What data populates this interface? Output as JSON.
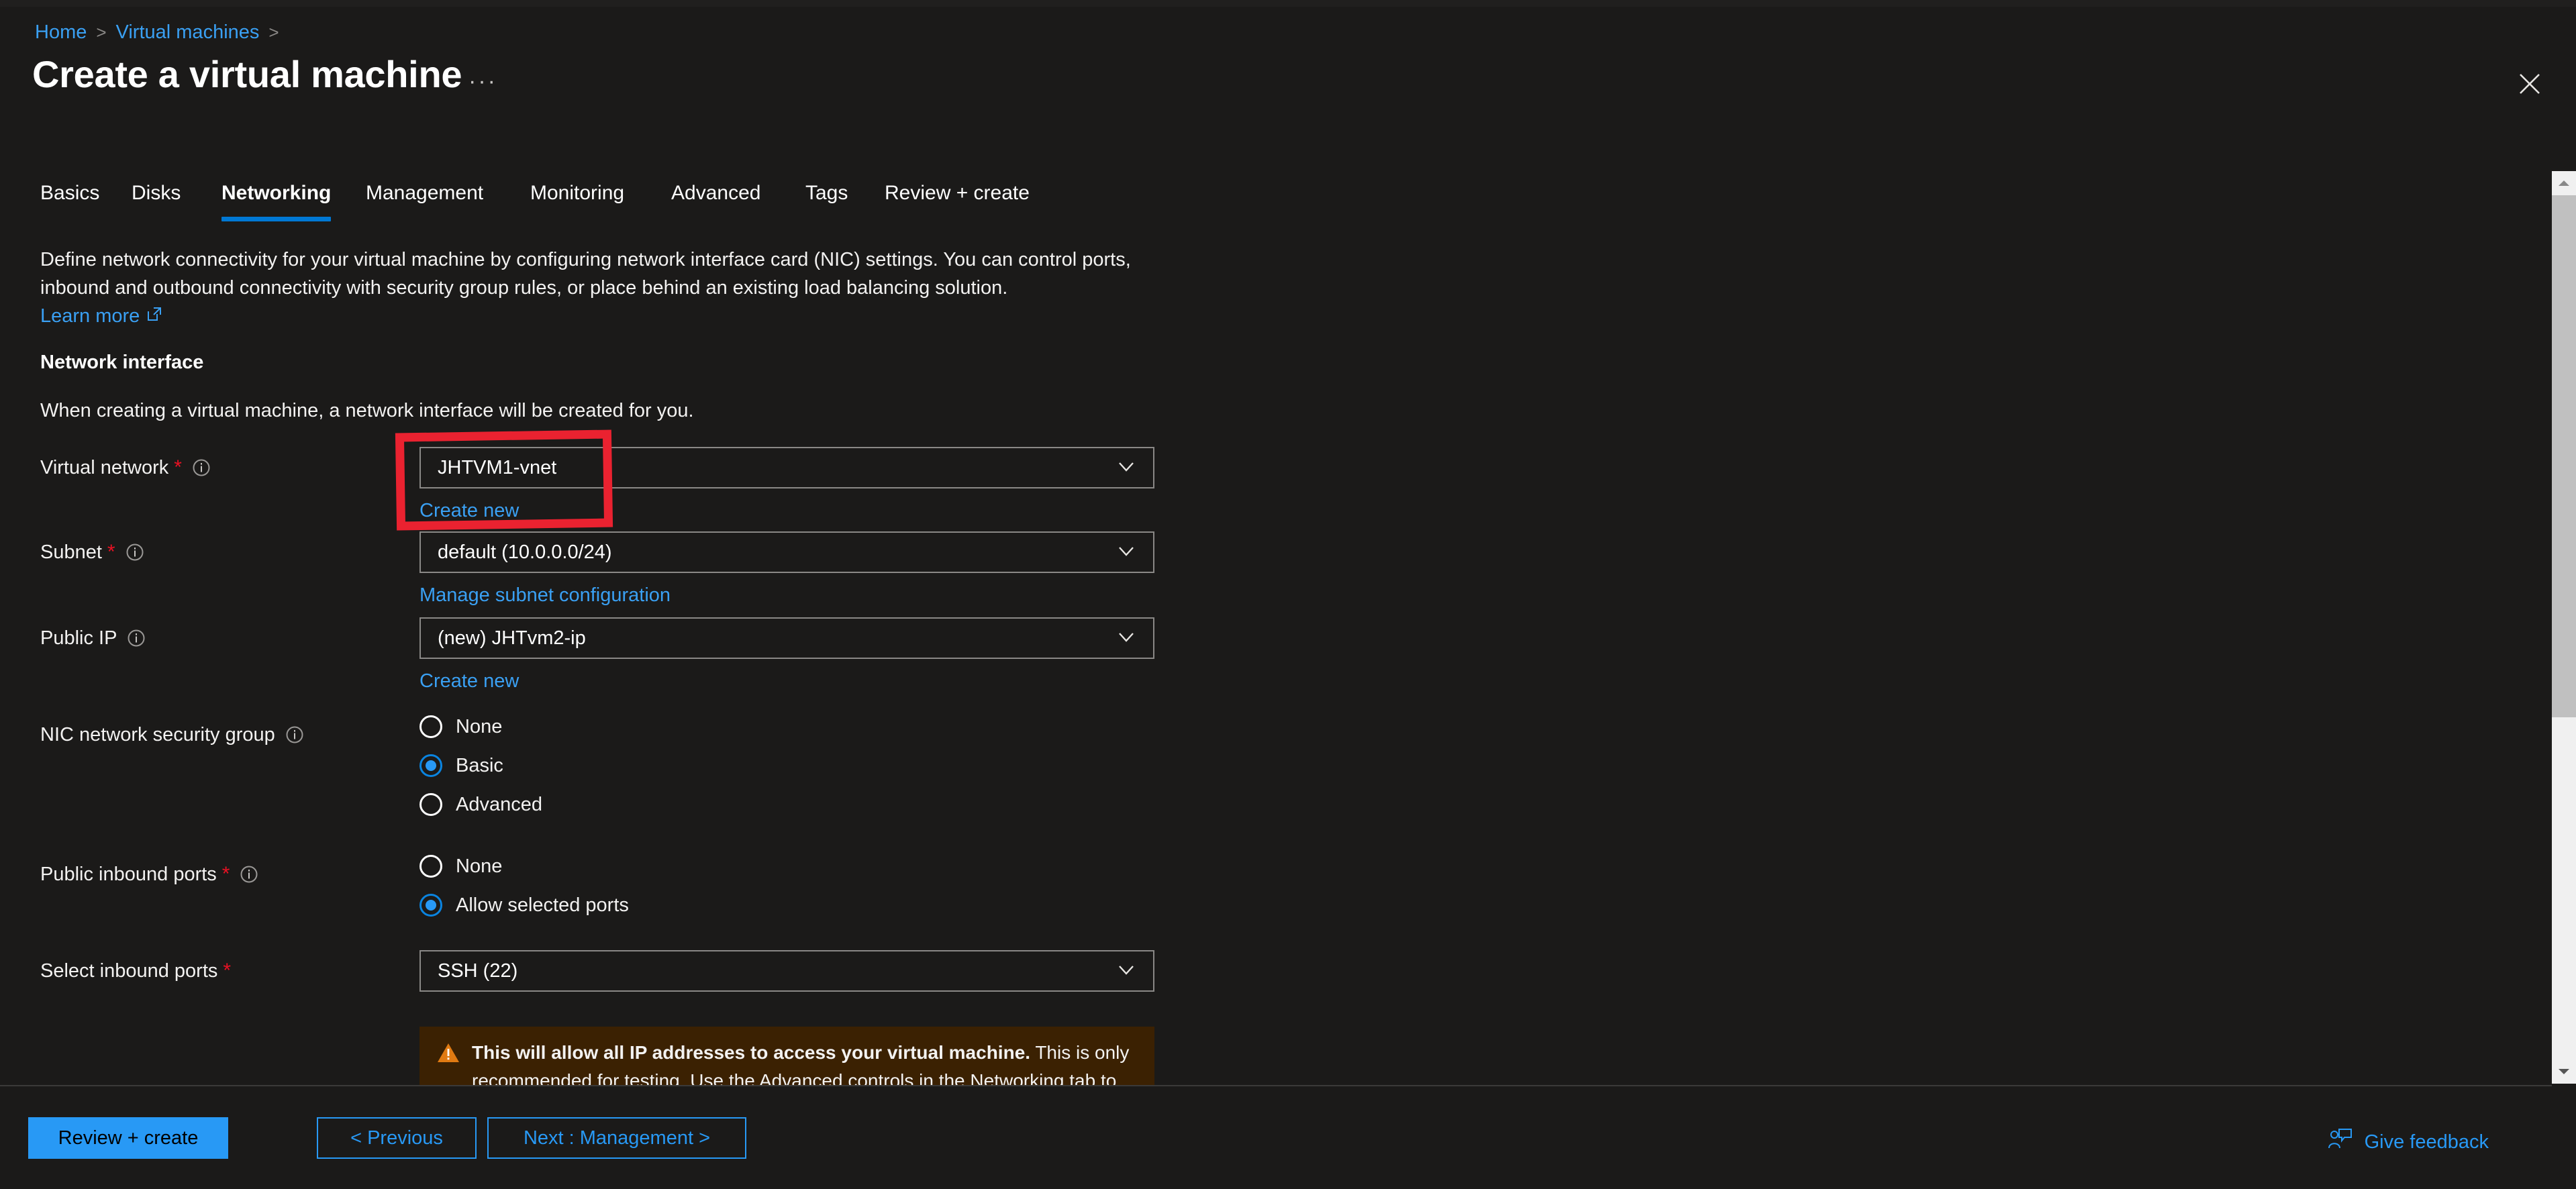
{
  "breadcrumb": {
    "items": [
      "Home",
      "Virtual machines"
    ],
    "separator": ">"
  },
  "header": {
    "title": "Create a virtual machine",
    "ellipsis": "···",
    "close_icon": "close-icon"
  },
  "tabs": [
    {
      "label": "Basics",
      "active": false
    },
    {
      "label": "Disks",
      "active": false
    },
    {
      "label": "Networking",
      "active": true
    },
    {
      "label": "Management",
      "active": false
    },
    {
      "label": "Monitoring",
      "active": false
    },
    {
      "label": "Advanced",
      "active": false
    },
    {
      "label": "Tags",
      "active": false
    },
    {
      "label": "Review + create",
      "active": false
    }
  ],
  "intro": {
    "paragraph": "Define network connectivity for your virtual machine by configuring network interface card (NIC) settings. You can control ports, inbound and outbound connectivity with security group rules, or place behind an existing load balancing solution.",
    "learn_more": "Learn more",
    "learn_more_icon": "external-link-icon"
  },
  "network_interface": {
    "heading": "Network interface",
    "subtext": "When creating a virtual machine, a network interface will be created for you."
  },
  "fields": {
    "virtual_network": {
      "label": "Virtual network",
      "required": true,
      "info_icon": "info-icon",
      "value": "JHTVM1-vnet",
      "sublink": "Create new",
      "chevron_icon": "chevron-down-icon",
      "highlighted": true
    },
    "subnet": {
      "label": "Subnet",
      "required": true,
      "info_icon": "info-icon",
      "value": "default (10.0.0.0/24)",
      "sublink": "Manage subnet configuration",
      "chevron_icon": "chevron-down-icon"
    },
    "public_ip": {
      "label": "Public IP",
      "required": false,
      "info_icon": "info-icon",
      "value": "(new) JHTvm2-ip",
      "sublink": "Create new",
      "chevron_icon": "chevron-down-icon"
    },
    "nic_nsg": {
      "label": "NIC network security group",
      "required": false,
      "info_icon": "info-icon",
      "options": [
        {
          "label": "None",
          "selected": false
        },
        {
          "label": "Basic",
          "selected": true
        },
        {
          "label": "Advanced",
          "selected": false
        }
      ]
    },
    "public_inbound_ports": {
      "label": "Public inbound ports",
      "required": true,
      "info_icon": "info-icon",
      "options": [
        {
          "label": "None",
          "selected": false
        },
        {
          "label": "Allow selected ports",
          "selected": true
        }
      ]
    },
    "select_inbound_ports": {
      "label": "Select inbound ports",
      "required": true,
      "value": "SSH (22)",
      "chevron_icon": "chevron-down-icon"
    }
  },
  "warning": {
    "icon": "warning-triangle-icon",
    "bold": "This will allow all IP addresses to access your virtual machine.",
    "rest": " This is only recommended for testing.  Use the Advanced controls in the Networking tab to"
  },
  "footer": {
    "review_create": "Review + create",
    "previous": "< Previous",
    "next": "Next : Management >",
    "feedback": "Give feedback",
    "feedback_icon": "feedback-person-icon"
  },
  "scrollbar": {
    "up_icon": "caret-up-icon",
    "down_icon": "caret-down-icon",
    "thumb": "scroll-thumb"
  },
  "colors": {
    "background": "#1b1a19",
    "accent": "#2899f5",
    "link": "#3aa0f3",
    "required_star": "#e81123",
    "annotation": "#ea2230",
    "warning_bg": "#3b2102",
    "warning_icon": "#e07a12",
    "tab_underline": "#0078d4"
  }
}
